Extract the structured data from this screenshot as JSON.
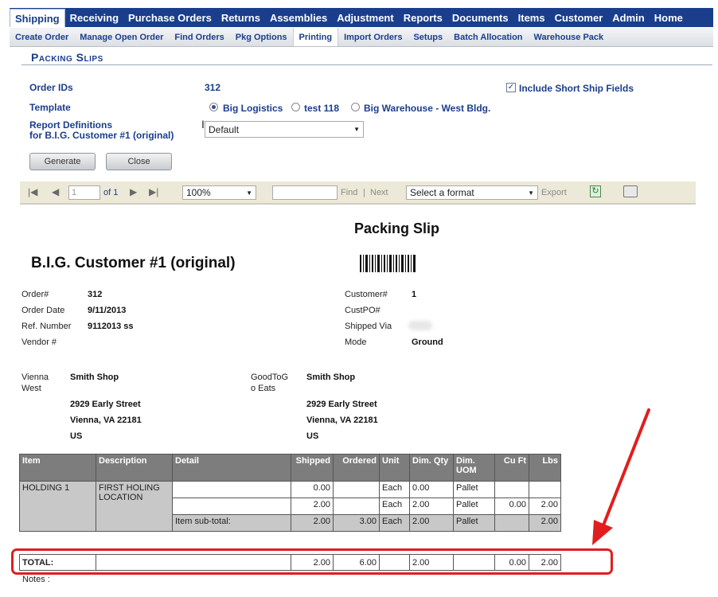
{
  "main_nav": [
    "Shipping",
    "Receiving",
    "Purchase Orders",
    "Returns",
    "Assemblies",
    "Adjustment",
    "Reports",
    "Documents",
    "Items",
    "Customer",
    "Admin",
    "Home"
  ],
  "sub_nav": [
    "Create Order",
    "Manage Open Order",
    "Find Orders",
    "Pkg Options",
    "Printing",
    "Import Orders",
    "Setups",
    "Batch Allocation",
    "Warehouse Pack"
  ],
  "page": {
    "title": "Packing Slips"
  },
  "form": {
    "order_ids_label": "Order IDs",
    "order_ids_value": "312",
    "template_label": "Template",
    "templates": [
      "Big Logistics",
      "test 118",
      "Big Warehouse - West Bldg."
    ],
    "report_def_label_1": "Report Definitions",
    "report_def_label_2": "for B.I.G. Customer #1 (original)",
    "report_def_value": "Default",
    "include_short_ship": "Include Short Ship Fields",
    "generate_label": "Generate",
    "close_label": "Close"
  },
  "toolbar": {
    "page_number": "1",
    "of_label": "of 1",
    "zoom": "100%",
    "find_label": "Find",
    "separator": "|",
    "next_label": "Next",
    "format_placeholder": "Select a format",
    "export_label": "Export"
  },
  "report": {
    "title": "Packing Slip",
    "customer_name": "B.I.G. Customer #1 (original)",
    "order_no_label": "Order#",
    "order_no": "312",
    "order_date_label": "Order Date",
    "order_date": "9/11/2013",
    "ref_label": "Ref. Number",
    "ref": "9112013 ss",
    "vendor_label": "Vendor #",
    "customer_no_label": "Customer#",
    "customer_no": "1",
    "custpo_label": "CustPO#",
    "shipped_via_label": "Shipped Via",
    "mode_label": "Mode",
    "mode": "Ground",
    "from_label_1": "Vienna",
    "from_label_2": "West",
    "from_name": "Smith Shop",
    "from_street": "2929 Early Street",
    "from_city": "Vienna, VA 22181",
    "from_country": "US",
    "to_label_1": "GoodToG",
    "to_label_2": "o Eats",
    "to_name": "Smith Shop",
    "to_street": "2929 Early Street",
    "to_city": "Vienna, VA 22181",
    "to_country": "US",
    "headers": [
      "Item",
      "Description",
      "Detail",
      "Shipped",
      "Ordered",
      "Unit",
      "Dim. Qty",
      "Dim. UOM",
      "Cu Ft",
      "Lbs"
    ],
    "item": "HOLDING 1",
    "description": "FIRST HOLING LOCATION",
    "rows": [
      {
        "detail": "",
        "shipped": "0.00",
        "ordered": "",
        "unit": "Each",
        "dim_qty": "0.00",
        "dim_uom": "Pallet",
        "cu_ft": "",
        "lbs": ""
      },
      {
        "detail": "",
        "shipped": "2.00",
        "ordered": "",
        "unit": "Each",
        "dim_qty": "2.00",
        "dim_uom": "Pallet",
        "cu_ft": "0.00",
        "lbs": "2.00"
      },
      {
        "detail": "Item sub-total:",
        "shipped": "2.00",
        "ordered": "3.00",
        "unit": "Each",
        "dim_qty": "2.00",
        "dim_uom": "Pallet",
        "cu_ft": "",
        "lbs": "2.00"
      }
    ],
    "total": {
      "label": "TOTAL:",
      "shipped": "2.00",
      "ordered": "6.00",
      "dim_qty": "2.00",
      "cu_ft": "0.00",
      "lbs": "2.00"
    },
    "notes_label": "Notes :"
  },
  "colors": {
    "nav_bg": "#1a3e8c",
    "highlight": "#e01e1e",
    "header_grey": "#7d7d7d"
  }
}
